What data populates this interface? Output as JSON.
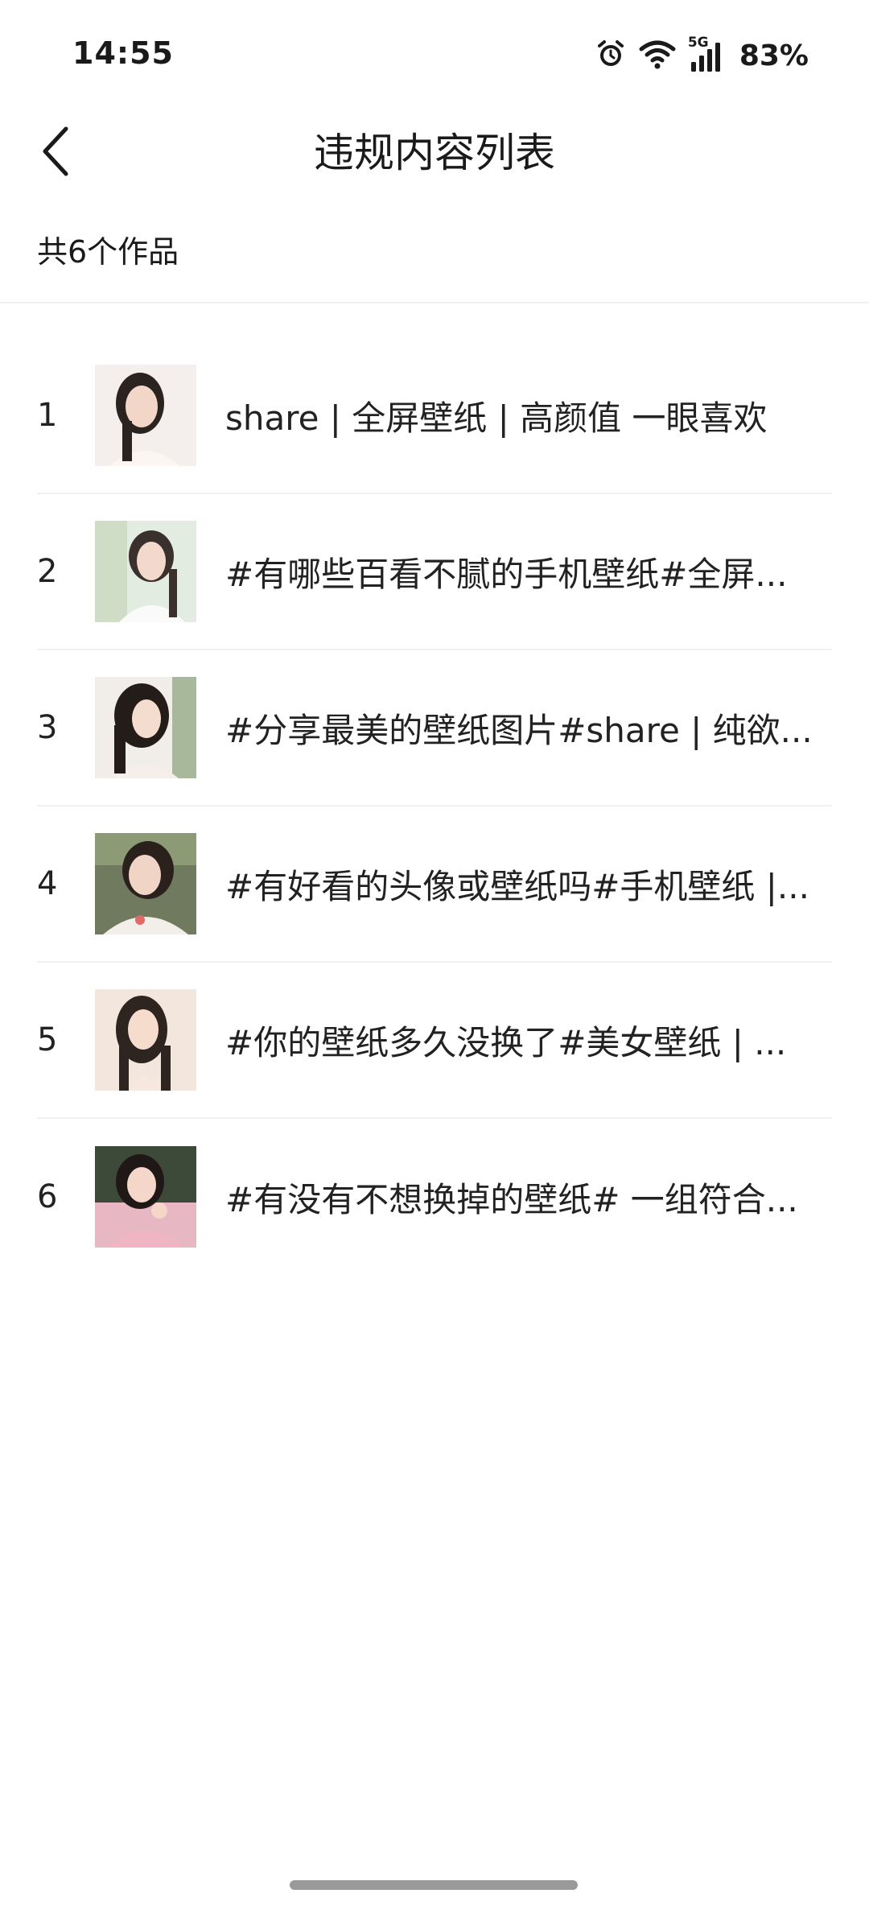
{
  "status_bar": {
    "time": "14:55",
    "network": "5G",
    "battery": "83%"
  },
  "header": {
    "title": "违规内容列表"
  },
  "summary": {
    "count_label": "共6个作品"
  },
  "items": [
    {
      "index": "1",
      "text": "share | 全屏壁纸 | 高颜值 一眼喜欢"
    },
    {
      "index": "2",
      "text": "#有哪些百看不腻的手机壁纸#全屏..."
    },
    {
      "index": "3",
      "text": "#分享最美的壁纸图片#share | 纯欲..."
    },
    {
      "index": "4",
      "text": "#有好看的头像或壁纸吗#手机壁纸 |..."
    },
    {
      "index": "5",
      "text": "#你的壁纸多久没换了#美女壁纸 | ..."
    },
    {
      "index": "6",
      "text": "#有没有不想换掉的壁纸# 一组符合..."
    }
  ],
  "icons": {
    "back": "chevron-left-icon",
    "alarm": "alarm-icon",
    "wifi": "wifi-icon",
    "signal": "signal-icon"
  },
  "colors": {
    "background": "#ffffff",
    "text": "#1a1a1a",
    "divider": "#f1f1f1"
  }
}
